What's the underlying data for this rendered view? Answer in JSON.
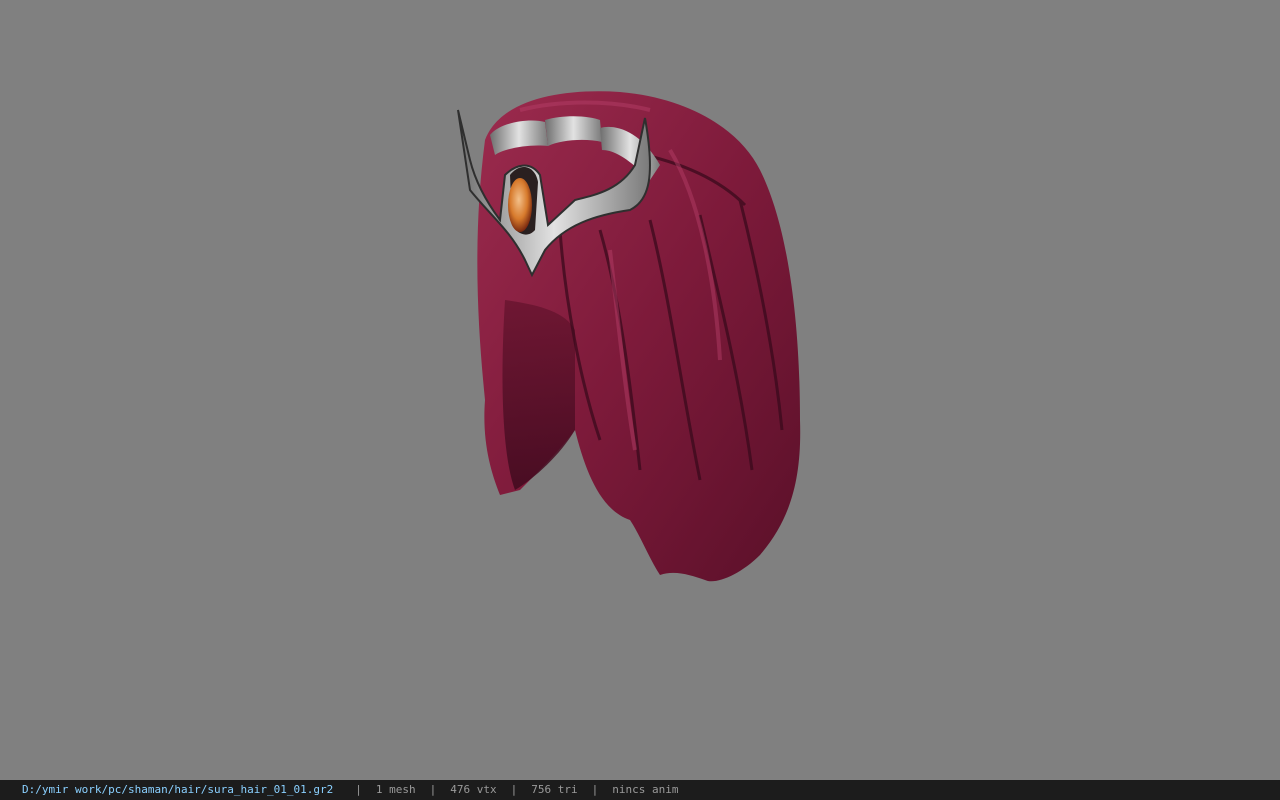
{
  "viewer": {
    "background_color": "#808080",
    "model_name": "sura_hair_01_01",
    "hair_color": "#8a1f3e",
    "metal_color": "#b8b8b8",
    "gem_color": "#e08a3c"
  },
  "status": {
    "path": "D:/ymir work/pc/shaman/hair/sura_hair_01_01.gr2",
    "meshes": "1 mesh",
    "vertices": "476 vtx",
    "triangles": "756 tri",
    "anim": "nincs anim"
  }
}
